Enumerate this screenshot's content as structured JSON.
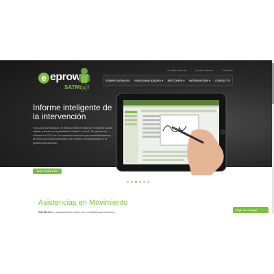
{
  "logo": {
    "brand": "eprowin",
    "product": "SATMovil"
  },
  "top_links": [
    "Contacto cliente",
    "Acceso cliente",
    "Contacto"
  ],
  "nav": {
    "items": [
      "SOBRE SATMOVIL",
      "FUNCIONALIDADES ▾",
      "SECTORES ▾",
      "INTEGRACIÓN ▾",
      "CONTACTO"
    ]
  },
  "hero": {
    "title": "Informe inteligente de la intervención",
    "body": "Tras una intervención, el técnico firma el informe, el cliente puede validar y firmar en la pantalla del tablet o móvil. Se genera un informe en PDF con los servicios técnicos que automáticamente se envía al correo electrónico del cliente y se almacena en la gestión documental.",
    "button_label": "MÁS DETALLES",
    "active_slide": 3,
    "slide_count": 6
  },
  "section": {
    "title": "Asistencias en Movimiento",
    "body_prefix": "SATMovil",
    "body": " es una aplicación online de movilidad para técnicos"
  },
  "chat": {
    "label": "Dejar un mensaje"
  },
  "colors": {
    "accent": "#7dc042",
    "hero_dark": "#1c1c1c"
  }
}
